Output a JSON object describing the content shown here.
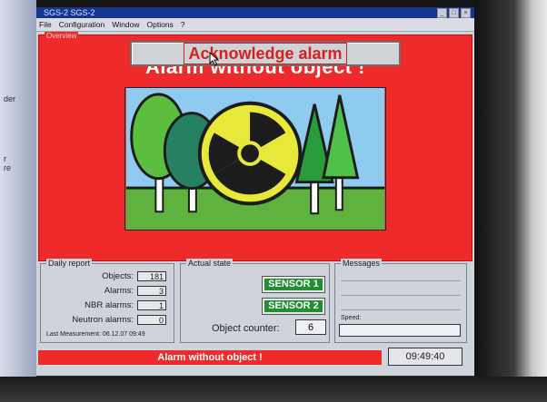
{
  "app": {
    "title": "SGS-2 SGS-2"
  },
  "menu": [
    {
      "label": "File"
    },
    {
      "label": "Configuration"
    },
    {
      "label": "Window"
    },
    {
      "label": "Options"
    },
    {
      "label": "?"
    }
  ],
  "overview": {
    "legend": "Overview",
    "acknowledge_label": "Acknowledge alarm",
    "alarm_title": "Alarm without object !"
  },
  "daily_report": {
    "legend": "Daily report",
    "rows": [
      {
        "label": "Objects:",
        "value": "181"
      },
      {
        "label": "Alarms:",
        "value": "3"
      },
      {
        "label": "NBR alarms:",
        "value": "1"
      },
      {
        "label": "Neutron alarms:",
        "value": "0"
      }
    ],
    "last_measurement_label": "Last Measurement:",
    "last_measurement_value": "06.12.07 09:49"
  },
  "actual_state": {
    "legend": "Actual state",
    "sensor1": "SENSOR 1",
    "sensor2": "SENSOR 2",
    "object_counter_label": "Object counter:",
    "object_counter_value": "6"
  },
  "messages": {
    "legend": "Messages",
    "speed_label": "Speed:"
  },
  "statusbar": {
    "message": "Alarm without object !",
    "time": "09:49:40"
  },
  "colors": {
    "alarm_red": "#ee2a2a",
    "sensor_green": "#1f8f2f",
    "title_blue": "#15368f",
    "radiation_yellow": "#e8e83a"
  },
  "icons": {
    "radiation": "radiation-icon"
  }
}
